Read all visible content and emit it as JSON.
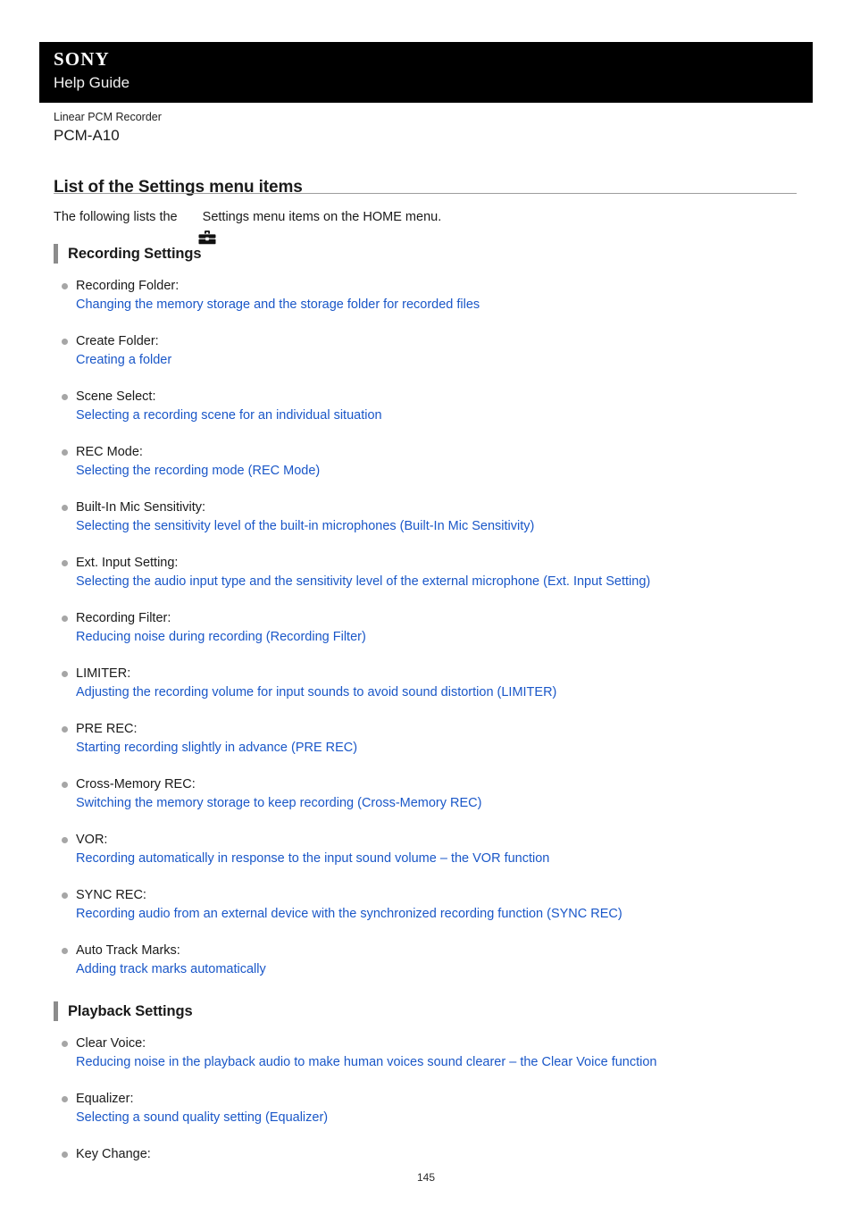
{
  "header": {
    "brand": "SONY",
    "subtitle": "Help Guide"
  },
  "product": {
    "category": "Linear PCM Recorder",
    "model": "PCM-A10"
  },
  "page": {
    "title": "List of the Settings menu items",
    "intro_before": "The following lists the ",
    "intro_icon": "toolbox-icon",
    "intro_after": "Settings menu items on the HOME menu.",
    "page_number": "145"
  },
  "colors": {
    "header_background": "#000000",
    "link": "#1a57c8",
    "section_bar": "#8c8c8c",
    "bullet": "#a6a6a6",
    "rule": "#9d9d9d",
    "text": "#1a1a1a"
  },
  "sections": [
    {
      "heading": "Recording Settings",
      "items": [
        {
          "label": "Recording Folder:",
          "link": "Changing the memory storage and the storage folder for recorded files"
        },
        {
          "label": "Create Folder:",
          "link": "Creating a folder"
        },
        {
          "label": "Scene Select:",
          "link": "Selecting a recording scene for an individual situation"
        },
        {
          "label": "REC Mode:",
          "link": "Selecting the recording mode (REC Mode)"
        },
        {
          "label": "Built-In Mic Sensitivity:",
          "link": "Selecting the sensitivity level of the built-in microphones (Built-In Mic Sensitivity)"
        },
        {
          "label": "Ext. Input Setting:",
          "link": "Selecting the audio input type and the sensitivity level of the external microphone (Ext. Input Setting)"
        },
        {
          "label": "Recording Filter:",
          "link": "Reducing noise during recording (Recording Filter)"
        },
        {
          "label": "LIMITER:",
          "link": "Adjusting the recording volume for input sounds to avoid sound distortion (LIMITER)"
        },
        {
          "label": "PRE REC:",
          "link": "Starting recording slightly in advance (PRE REC)"
        },
        {
          "label": "Cross-Memory REC:",
          "link": "Switching the memory storage to keep recording (Cross-Memory REC)"
        },
        {
          "label": "VOR:",
          "link": "Recording automatically in response to the input sound volume – the VOR function"
        },
        {
          "label": "SYNC REC:",
          "link": "Recording audio from an external device with the synchronized recording function (SYNC REC)"
        },
        {
          "label": "Auto Track Marks:",
          "link": "Adding track marks automatically"
        }
      ]
    },
    {
      "heading": "Playback Settings",
      "items": [
        {
          "label": "Clear Voice:",
          "link": "Reducing noise in the playback audio to make human voices sound clearer – the Clear Voice function"
        },
        {
          "label": "Equalizer:",
          "link": "Selecting a sound quality setting (Equalizer)"
        },
        {
          "label": "Key Change:",
          "link": ""
        }
      ]
    }
  ]
}
